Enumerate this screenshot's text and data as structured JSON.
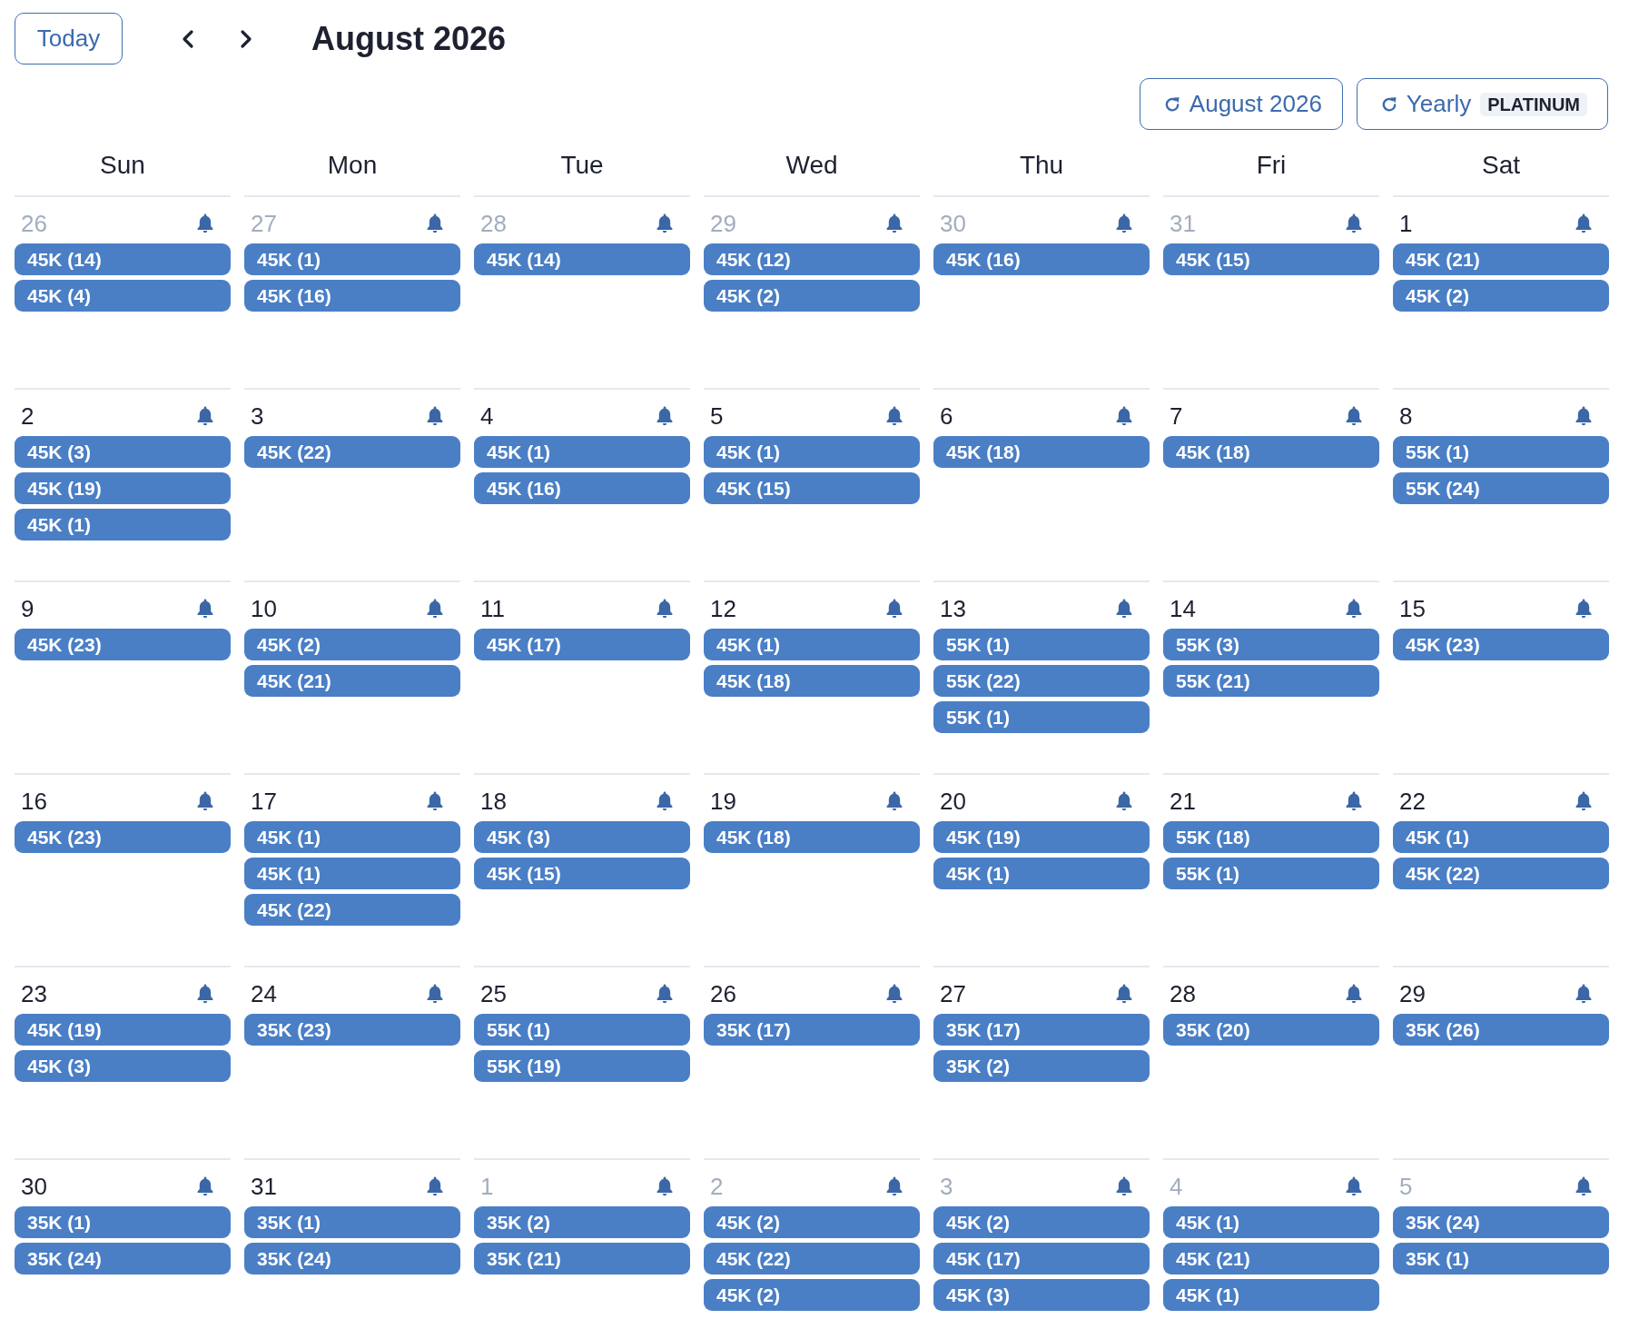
{
  "toolbar": {
    "today_button": "Today",
    "title": "August 2026"
  },
  "sync_buttons": [
    {
      "label": "August 2026"
    },
    {
      "label": "Yearly",
      "badge": "PLATINUM"
    }
  ],
  "weekdays": [
    "Sun",
    "Mon",
    "Tue",
    "Wed",
    "Thu",
    "Fri",
    "Sat"
  ],
  "weeks": [
    [
      {
        "day": "26",
        "in_month": false,
        "events": [
          "45K (14)",
          "45K (4)"
        ]
      },
      {
        "day": "27",
        "in_month": false,
        "events": [
          "45K (1)",
          "45K (16)"
        ]
      },
      {
        "day": "28",
        "in_month": false,
        "events": [
          "45K (14)"
        ]
      },
      {
        "day": "29",
        "in_month": false,
        "events": [
          "45K (12)",
          "45K (2)"
        ]
      },
      {
        "day": "30",
        "in_month": false,
        "events": [
          "45K (16)"
        ]
      },
      {
        "day": "31",
        "in_month": false,
        "events": [
          "45K (15)"
        ]
      },
      {
        "day": "1",
        "in_month": true,
        "events": [
          "45K (21)",
          "45K (2)"
        ]
      }
    ],
    [
      {
        "day": "2",
        "in_month": true,
        "events": [
          "45K (3)",
          "45K (19)",
          "45K (1)"
        ]
      },
      {
        "day": "3",
        "in_month": true,
        "events": [
          "45K (22)"
        ]
      },
      {
        "day": "4",
        "in_month": true,
        "events": [
          "45K (1)",
          "45K (16)"
        ]
      },
      {
        "day": "5",
        "in_month": true,
        "events": [
          "45K (1)",
          "45K (15)"
        ]
      },
      {
        "day": "6",
        "in_month": true,
        "events": [
          "45K (18)"
        ]
      },
      {
        "day": "7",
        "in_month": true,
        "events": [
          "45K (18)"
        ]
      },
      {
        "day": "8",
        "in_month": true,
        "events": [
          "55K (1)",
          "55K (24)"
        ]
      }
    ],
    [
      {
        "day": "9",
        "in_month": true,
        "events": [
          "45K (23)"
        ]
      },
      {
        "day": "10",
        "in_month": true,
        "events": [
          "45K (2)",
          "45K (21)"
        ]
      },
      {
        "day": "11",
        "in_month": true,
        "events": [
          "45K (17)"
        ]
      },
      {
        "day": "12",
        "in_month": true,
        "events": [
          "45K (1)",
          "45K (18)"
        ]
      },
      {
        "day": "13",
        "in_month": true,
        "events": [
          "55K (1)",
          "55K (22)",
          "55K (1)"
        ]
      },
      {
        "day": "14",
        "in_month": true,
        "events": [
          "55K (3)",
          "55K (21)"
        ]
      },
      {
        "day": "15",
        "in_month": true,
        "events": [
          "45K (23)"
        ]
      }
    ],
    [
      {
        "day": "16",
        "in_month": true,
        "events": [
          "45K (23)"
        ]
      },
      {
        "day": "17",
        "in_month": true,
        "events": [
          "45K (1)",
          "45K (1)",
          "45K (22)"
        ]
      },
      {
        "day": "18",
        "in_month": true,
        "events": [
          "45K (3)",
          "45K (15)"
        ]
      },
      {
        "day": "19",
        "in_month": true,
        "events": [
          "45K (18)"
        ]
      },
      {
        "day": "20",
        "in_month": true,
        "events": [
          "45K (19)",
          "45K (1)"
        ]
      },
      {
        "day": "21",
        "in_month": true,
        "events": [
          "55K (18)",
          "55K (1)"
        ]
      },
      {
        "day": "22",
        "in_month": true,
        "events": [
          "45K (1)",
          "45K (22)"
        ]
      }
    ],
    [
      {
        "day": "23",
        "in_month": true,
        "events": [
          "45K (19)",
          "45K (3)"
        ]
      },
      {
        "day": "24",
        "in_month": true,
        "events": [
          "35K (23)"
        ]
      },
      {
        "day": "25",
        "in_month": true,
        "events": [
          "55K (1)",
          "55K (19)"
        ]
      },
      {
        "day": "26",
        "in_month": true,
        "events": [
          "35K (17)"
        ]
      },
      {
        "day": "27",
        "in_month": true,
        "events": [
          "35K (17)",
          "35K (2)"
        ]
      },
      {
        "day": "28",
        "in_month": true,
        "events": [
          "35K (20)"
        ]
      },
      {
        "day": "29",
        "in_month": true,
        "events": [
          "35K (26)"
        ]
      }
    ],
    [
      {
        "day": "30",
        "in_month": true,
        "events": [
          "35K (1)",
          "35K (24)"
        ]
      },
      {
        "day": "31",
        "in_month": true,
        "events": [
          "35K (1)",
          "35K (24)"
        ]
      },
      {
        "day": "1",
        "in_month": false,
        "events": [
          "35K (2)",
          "35K (21)"
        ]
      },
      {
        "day": "2",
        "in_month": false,
        "events": [
          "45K (2)",
          "45K (22)",
          "45K (2)"
        ]
      },
      {
        "day": "3",
        "in_month": false,
        "events": [
          "45K (2)",
          "45K (17)",
          "45K (3)"
        ]
      },
      {
        "day": "4",
        "in_month": false,
        "events": [
          "45K (1)",
          "45K (21)",
          "45K (1)"
        ]
      },
      {
        "day": "5",
        "in_month": false,
        "events": [
          "35K (24)",
          "35K (1)"
        ]
      }
    ]
  ]
}
